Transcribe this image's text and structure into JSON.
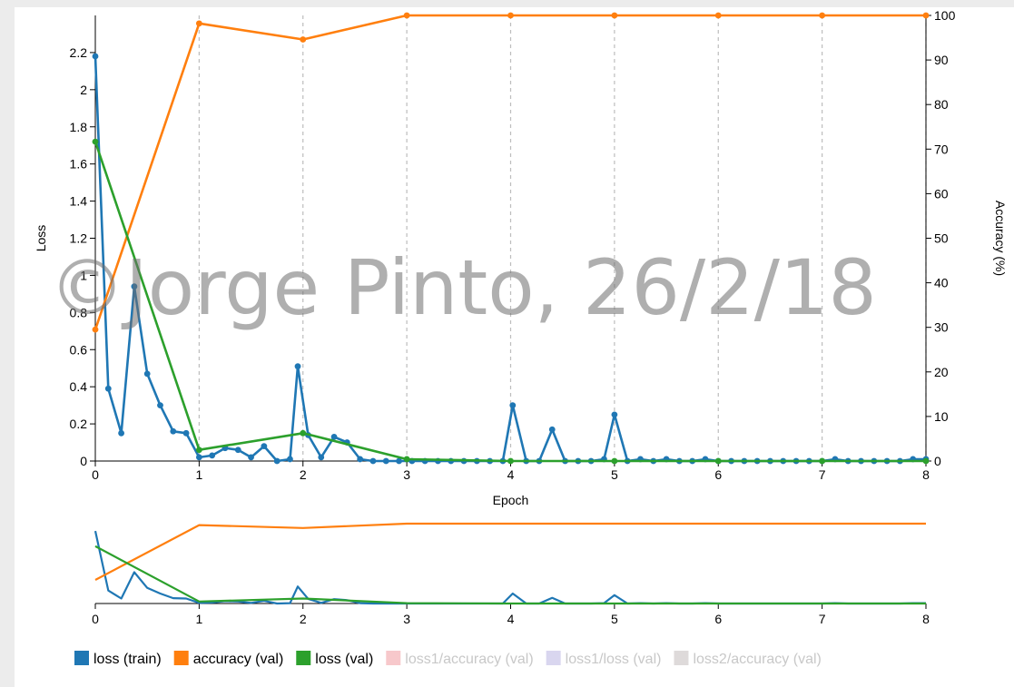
{
  "watermark": "©Jorge Pinto, 26/2/18",
  "chart_data": {
    "type": "line",
    "xlabel": "Epoch",
    "ylabel_left": "Loss",
    "ylabel_right": "Accuracy (%)",
    "xlim": [
      0,
      8
    ],
    "ylim_left": [
      0,
      2.4
    ],
    "ylim_right": [
      0,
      100
    ],
    "x_ticks": [
      0,
      1,
      2,
      3,
      4,
      5,
      6,
      7,
      8
    ],
    "y_left_ticks": [
      0,
      0.2,
      0.4,
      0.6,
      0.8,
      1,
      1.2,
      1.4,
      1.6,
      1.8,
      2,
      2.2
    ],
    "y_right_ticks": [
      0,
      10,
      20,
      30,
      40,
      50,
      60,
      70,
      80,
      90,
      100
    ],
    "grid": "vertical dashed at epochs",
    "legend_placement": "bottom",
    "series": [
      {
        "name": "loss (train)",
        "axis": "left",
        "color": "#1f77b4",
        "x": [
          0,
          0.125,
          0.25,
          0.375,
          0.5,
          0.625,
          0.75,
          0.875,
          1.0,
          1.125,
          1.25,
          1.375,
          1.5,
          1.625,
          1.75,
          1.875,
          1.95,
          2.05,
          2.175,
          2.3,
          2.425,
          2.55,
          2.675,
          2.8,
          2.925,
          3.05,
          3.175,
          3.3,
          3.425,
          3.55,
          3.675,
          3.8,
          3.925,
          4.02,
          4.15,
          4.275,
          4.4,
          4.525,
          4.65,
          4.775,
          4.9,
          5.0,
          5.125,
          5.25,
          5.375,
          5.5,
          5.625,
          5.75,
          5.875,
          6.0,
          6.125,
          6.25,
          6.375,
          6.5,
          6.625,
          6.75,
          6.875,
          7.0,
          7.125,
          7.25,
          7.375,
          7.5,
          7.625,
          7.75,
          7.875,
          8.0
        ],
        "y": [
          2.18,
          0.39,
          0.15,
          0.94,
          0.47,
          0.3,
          0.16,
          0.15,
          0.02,
          0.03,
          0.07,
          0.06,
          0.02,
          0.08,
          0.0,
          0.01,
          0.51,
          0.14,
          0.02,
          0.13,
          0.1,
          0.01,
          0.0,
          0.0,
          0.0,
          0.0,
          0.0,
          0.0,
          0.0,
          0.0,
          0.0,
          0.0,
          0.0,
          0.3,
          0.0,
          0.0,
          0.17,
          0.0,
          0.0,
          0.0,
          0.01,
          0.25,
          0.0,
          0.01,
          0.0,
          0.01,
          0.0,
          0.0,
          0.01,
          0.0,
          0.0,
          0.0,
          0.0,
          0.0,
          0.0,
          0.0,
          0.0,
          0.0,
          0.01,
          0.0,
          0.0,
          0.0,
          0.0,
          0.0,
          0.01,
          0.01
        ]
      },
      {
        "name": "accuracy (val)",
        "axis": "right",
        "color": "#ff7f0e",
        "x": [
          0,
          1,
          2,
          3,
          4,
          5,
          6,
          7,
          8
        ],
        "y": [
          29.5,
          98.2,
          94.6,
          100,
          100,
          100,
          100,
          100,
          100
        ]
      },
      {
        "name": "loss (val)",
        "axis": "left",
        "color": "#2ca02c",
        "x": [
          0,
          1,
          2,
          3,
          4,
          5,
          6,
          7,
          8
        ],
        "y": [
          1.72,
          0.06,
          0.15,
          0.01,
          0.0,
          0.0,
          0.0,
          0.0,
          0.0
        ]
      }
    ],
    "legend": [
      {
        "name": "loss (train)",
        "color": "#1f77b4",
        "active": true
      },
      {
        "name": "accuracy (val)",
        "color": "#ff7f0e",
        "active": true
      },
      {
        "name": "loss (val)",
        "color": "#2ca02c",
        "active": true
      },
      {
        "name": "loss1/accuracy (val)",
        "color": "#f7c8cb",
        "active": false
      },
      {
        "name": "loss1/loss (val)",
        "color": "#d9d6ef",
        "active": false
      },
      {
        "name": "loss2/accuracy (val)",
        "color": "#dedada",
        "active": false
      }
    ]
  }
}
